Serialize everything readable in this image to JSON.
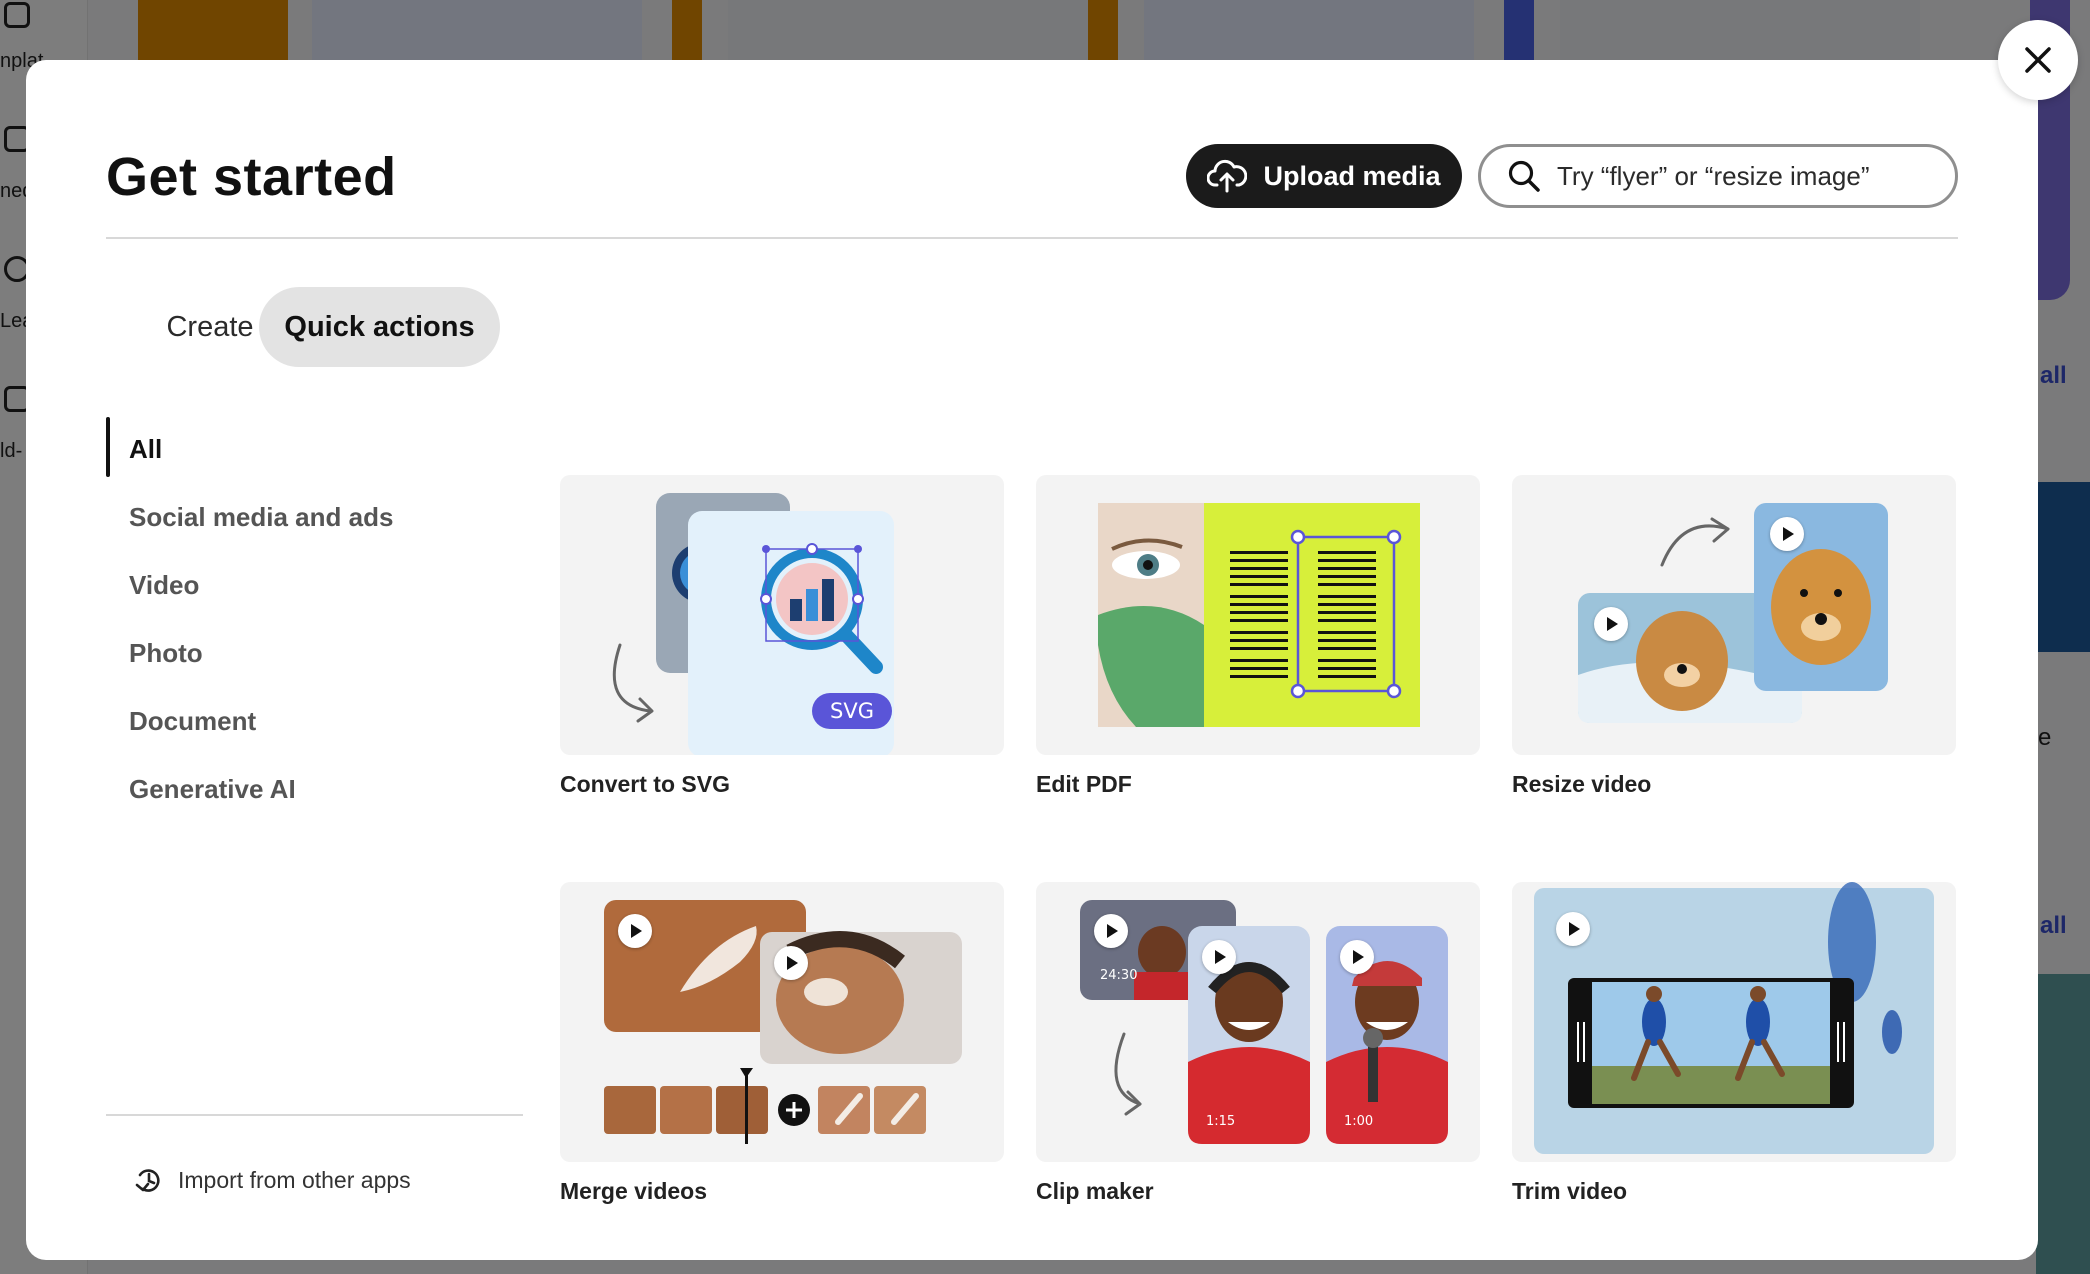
{
  "modal": {
    "title": "Get started",
    "upload_label": "Upload media",
    "search_placeholder": "Try “flyer” or “resize image”",
    "tabs": [
      {
        "label": "Create",
        "active": false
      },
      {
        "label": "Quick actions",
        "active": true
      }
    ],
    "categories": [
      {
        "label": "All",
        "active": true
      },
      {
        "label": "Social media and ads",
        "active": false
      },
      {
        "label": "Video",
        "active": false
      },
      {
        "label": "Photo",
        "active": false
      },
      {
        "label": "Document",
        "active": false
      },
      {
        "label": "Generative AI",
        "active": false
      }
    ],
    "import_label": "Import from other apps",
    "cards": [
      {
        "label": "Convert to SVG",
        "badge": "SVG"
      },
      {
        "label": "Edit PDF"
      },
      {
        "label": "Resize video"
      },
      {
        "label": "Merge videos"
      },
      {
        "label": "Clip maker",
        "timecodes": [
          "24:30",
          "1:15",
          "1:00"
        ]
      },
      {
        "label": "Trim video"
      }
    ]
  },
  "background": {
    "sidebar_labels": [
      "nplat",
      "ned",
      "Lea",
      "ld-"
    ],
    "links": [
      "all",
      "all"
    ],
    "partial_text": "e"
  },
  "colors": {
    "upload_bg": "#1b1b1b",
    "tab_active_bg": "#e3e3e3",
    "accent_blue": "#3a4fd0",
    "svg_badge": "#5a55d8"
  }
}
